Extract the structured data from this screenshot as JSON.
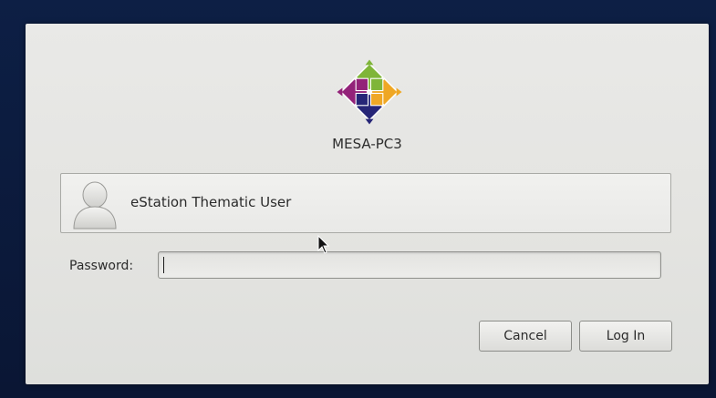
{
  "login": {
    "hostname": "MESA-PC3",
    "user": {
      "name": "eStation Thematic User",
      "avatar_icon": "user-avatar-icon"
    },
    "password": {
      "label": "Password:",
      "value": "",
      "placeholder": ""
    },
    "buttons": {
      "cancel_label": "Cancel",
      "login_label": "Log In"
    }
  },
  "colors": {
    "logo_green": "#7fb539",
    "logo_purple": "#932279",
    "logo_orange": "#efa724",
    "logo_navy": "#262577"
  }
}
